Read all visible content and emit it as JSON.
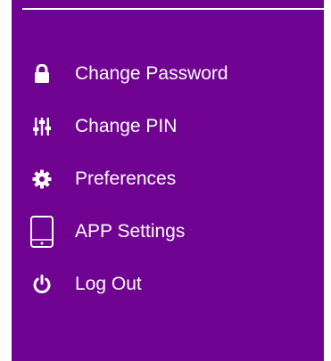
{
  "menu": {
    "background": "#6f0291",
    "text_color": "#ffffff",
    "items": [
      {
        "label": "Change Password",
        "icon": "lock-icon"
      },
      {
        "label": "Change PIN",
        "icon": "sliders-icon"
      },
      {
        "label": "Preferences",
        "icon": "gear-icon"
      },
      {
        "label": "APP Settings",
        "icon": "mobile-phone-icon"
      },
      {
        "label": "Log Out",
        "icon": "power-icon"
      }
    ]
  }
}
